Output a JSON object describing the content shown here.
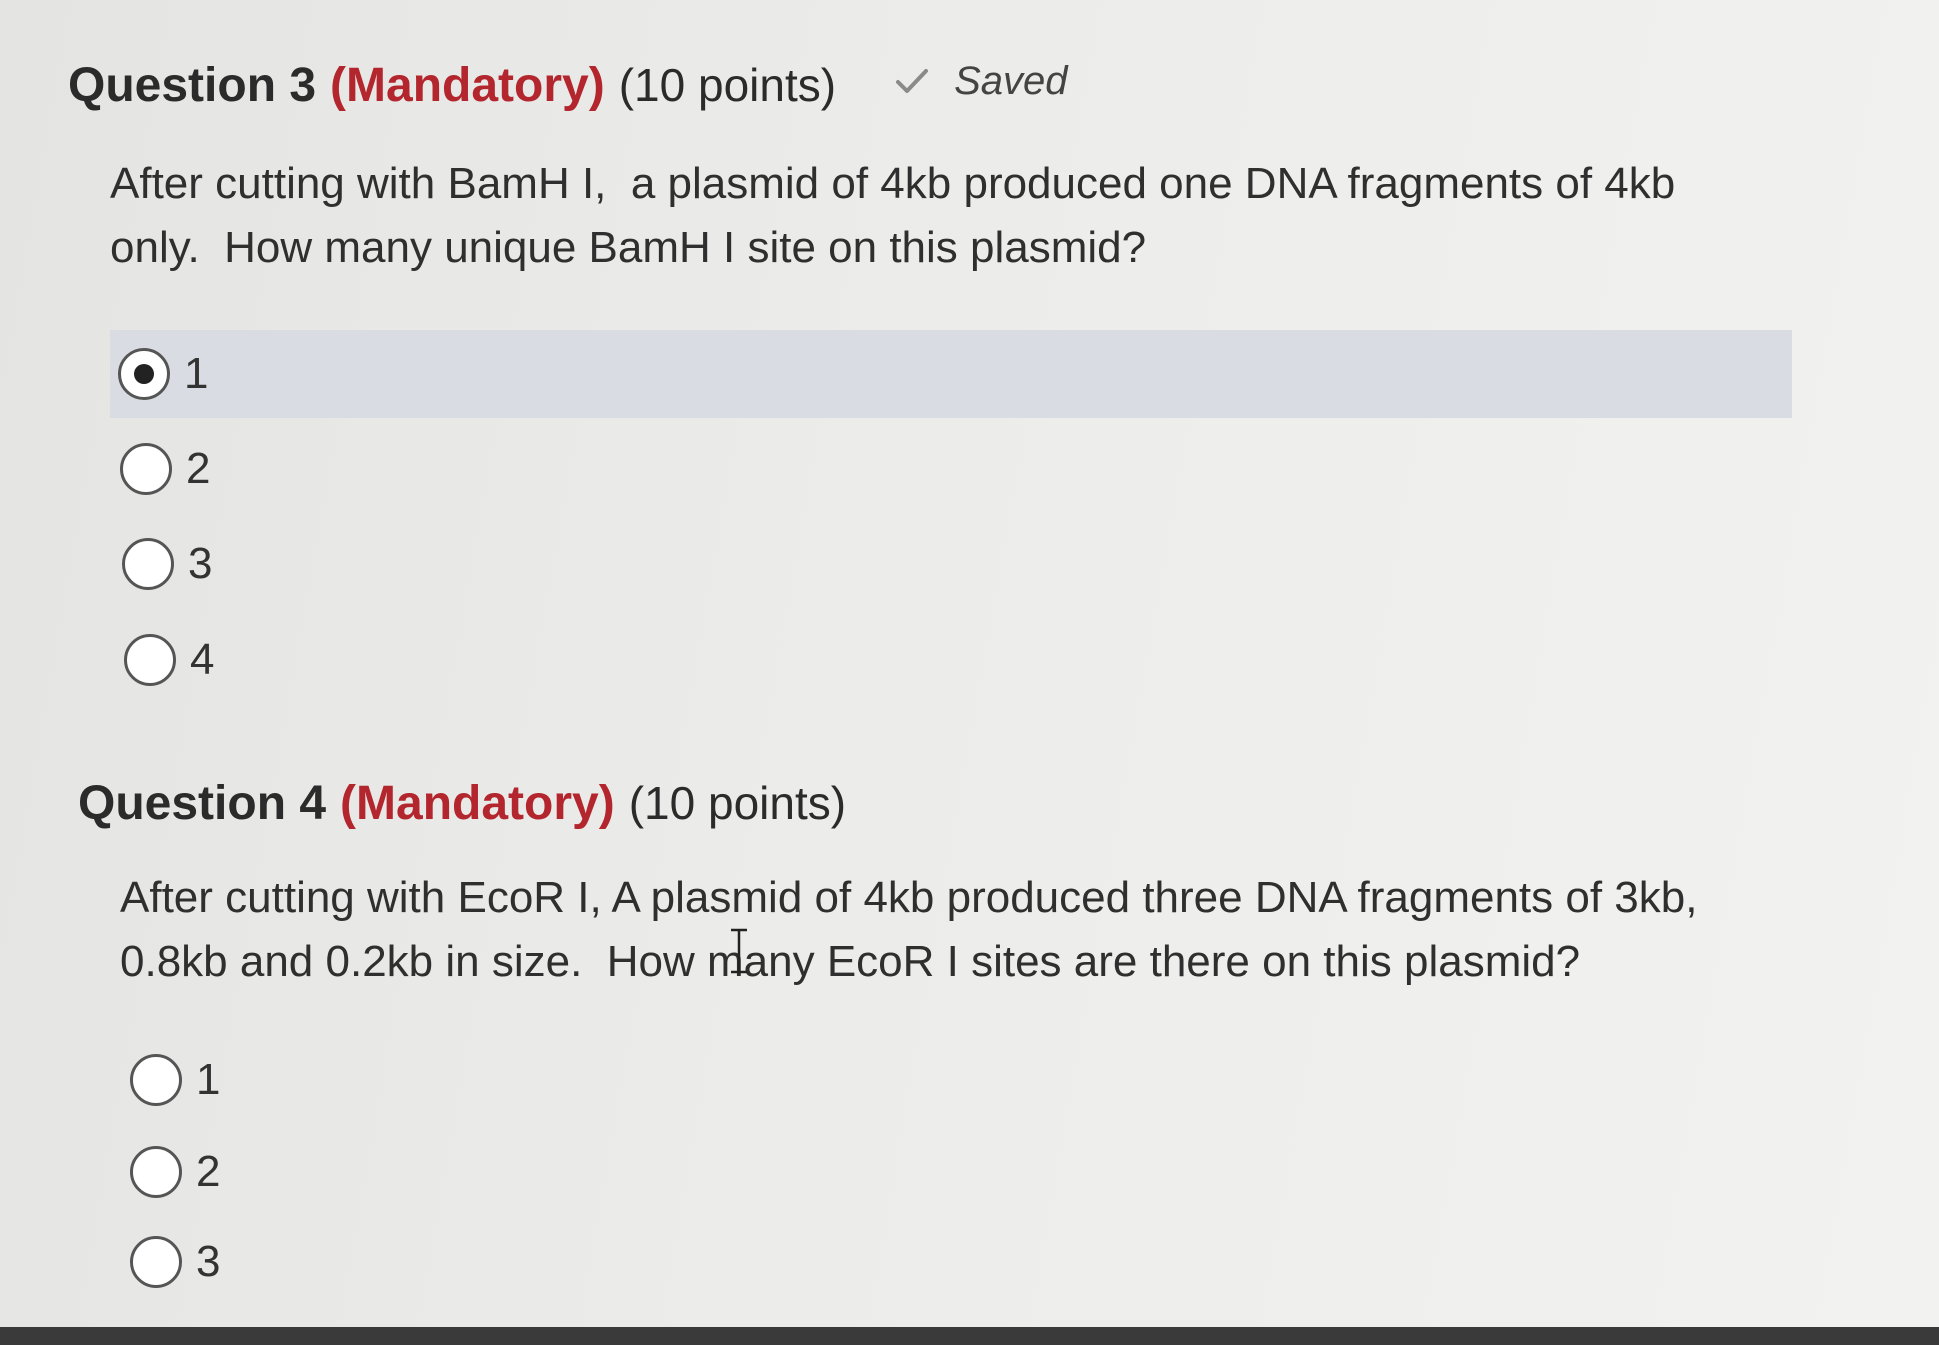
{
  "question3": {
    "title": "Question 3",
    "mandatory": "(Mandatory)",
    "points": "(10 points)",
    "saved_label": "Saved",
    "body_line1": "After cutting with BamH I,  a plasmid of 4kb produced one DNA fragments of 4kb",
    "body_line2": "only.  How many unique BamH I site on this plasmid?",
    "options": [
      {
        "label": "1",
        "selected": true
      },
      {
        "label": "2",
        "selected": false
      },
      {
        "label": "3",
        "selected": false
      },
      {
        "label": "4",
        "selected": false
      }
    ]
  },
  "question4": {
    "title": "Question 4",
    "mandatory": "(Mandatory)",
    "points": "(10 points)",
    "body_line1": "After cutting with EcoR I, A plasmid of 4kb produced three DNA fragments of 3kb,",
    "body_line2": "0.8kb and 0.2kb in size.  How many EcoR I sites are there on this plasmid?",
    "options": [
      {
        "label": "1",
        "selected": false
      },
      {
        "label": "2",
        "selected": false
      },
      {
        "label": "3",
        "selected": false
      }
    ]
  },
  "colors": {
    "mandatory": "#b3262d",
    "selected_row": "#d9dde3"
  },
  "icons": {
    "saved": "check-icon",
    "cursor": "text-cursor-icon"
  }
}
